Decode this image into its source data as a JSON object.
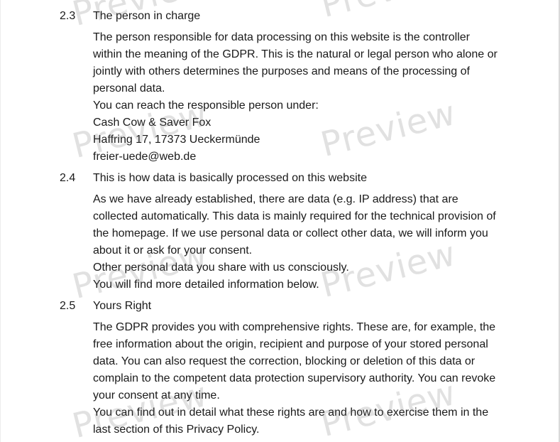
{
  "sections": [
    {
      "number": "2.3",
      "title": "The person in charge",
      "lines": [
        "The person responsible for data processing on this website is the controller",
        "within the meaning of the GDPR. This is the natural or legal person who alone or",
        "jointly with others determines the purposes and means of the processing of",
        "personal data.",
        "You can reach the responsible person under:",
        "Cash Cow & Saver Fox",
        "Haffring 17, 17373 Ueckermünde",
        "freier-uede@web.de"
      ]
    },
    {
      "number": "2.4",
      "title": "This is how data is basically processed on this website",
      "lines": [
        "As we have already established, there are data (e.g. IP address) that are",
        "collected automatically. This data is mainly required for the technical provision of",
        "the homepage. If we use personal data or collect other data, we will inform you",
        "about it or ask for your consent.",
        "Other personal data you share with us consciously.",
        "You will find more detailed information below."
      ]
    },
    {
      "number": "2.5",
      "title": "Yours Right",
      "lines": [
        "The GDPR provides you with comprehensive rights. These are, for example, the",
        "free information about the origin, recipient and purpose of your stored personal",
        "data. You can also request the correction, blocking or deletion of this data or",
        "complain to the competent data protection supervisory authority. You can revoke",
        "your consent at any time.",
        "You can find out in detail what these rights are and how to exercise them in the",
        "last section of this Privacy Policy."
      ]
    }
  ],
  "watermark_text": "Preview"
}
